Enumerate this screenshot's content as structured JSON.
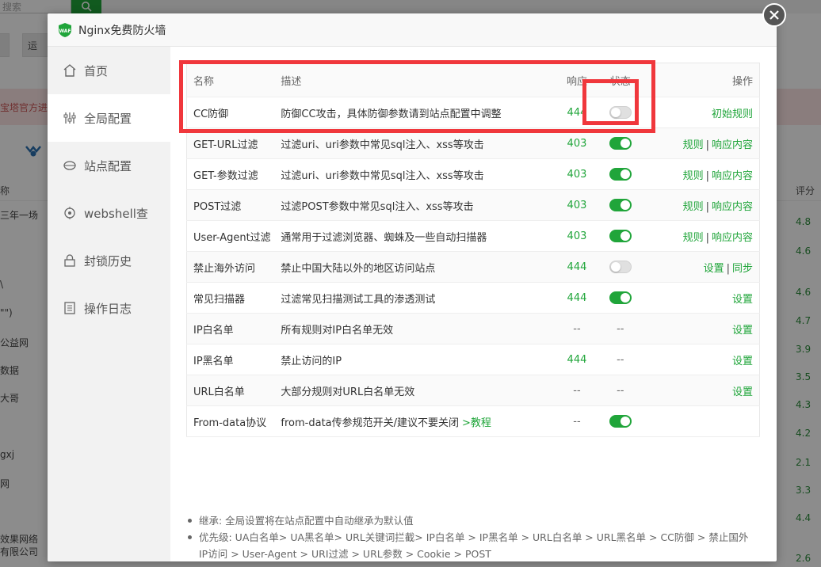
{
  "background": {
    "search_placeholder": "搜索",
    "tab_partial": "运",
    "banner_partial": "宝塔官方进",
    "col_partial": "称",
    "col_score": "评分",
    "rows": [
      {
        "name": "三年一场",
        "score": "4.8"
      },
      {
        "name": "",
        "score": "4.6"
      },
      {
        "name": "\\",
        "score": "4.6"
      },
      {
        "name": "\"\")",
        "score": "4.7"
      },
      {
        "name": "公益网",
        "score": "3.9"
      },
      {
        "name": "数据",
        "score": "3.5"
      },
      {
        "name": "大哥",
        "score": "4.3"
      },
      {
        "name": "",
        "score": "4.2"
      },
      {
        "name": "gxj",
        "score": "2.1"
      },
      {
        "name": "网",
        "score": "3.3"
      },
      {
        "name": "",
        "score": "4.4"
      },
      {
        "name": "效果网络",
        "score": ""
      },
      {
        "name": "有限公司",
        "score": "2.6"
      }
    ]
  },
  "modal": {
    "title": "Nginx免费防火墙",
    "close_icon": "close-icon"
  },
  "sidebar": {
    "items": [
      {
        "label": "首页",
        "icon": "home-icon"
      },
      {
        "label": "全局配置",
        "icon": "sliders-icon"
      },
      {
        "label": "站点配置",
        "icon": "site-icon"
      },
      {
        "label": "webshell查",
        "icon": "target-icon"
      },
      {
        "label": "封锁历史",
        "icon": "lock-icon"
      },
      {
        "label": "操作日志",
        "icon": "log-icon"
      }
    ]
  },
  "table": {
    "headers": {
      "name": "名称",
      "desc": "描述",
      "resp": "响应",
      "state": "状态",
      "ops": "操作"
    },
    "rows": [
      {
        "name": "CC防御",
        "desc": "防御CC攻击，具体防御参数请到站点配置中调整",
        "resp": "444",
        "state": "off",
        "ops": [
          "初始规则"
        ]
      },
      {
        "name": "GET-URL过滤",
        "desc": "过滤uri、uri参数中常见sql注入、xss等攻击",
        "resp": "403",
        "state": "on",
        "ops": [
          "规则",
          "响应内容"
        ]
      },
      {
        "name": "GET-参数过滤",
        "desc": "过滤uri、uri参数中常见sql注入、xss等攻击",
        "resp": "403",
        "state": "on",
        "ops": [
          "规则",
          "响应内容"
        ]
      },
      {
        "name": "POST过滤",
        "desc": "过滤POST参数中常见sql注入、xss等攻击",
        "resp": "403",
        "state": "on",
        "ops": [
          "规则",
          "响应内容"
        ]
      },
      {
        "name": "User-Agent过滤",
        "desc": "通常用于过滤浏览器、蜘蛛及一些自动扫描器",
        "resp": "403",
        "state": "on",
        "ops": [
          "规则",
          "响应内容"
        ]
      },
      {
        "name": "禁止海外访问",
        "desc": "禁止中国大陆以外的地区访问站点",
        "resp": "444",
        "state": "off",
        "ops": [
          "设置",
          "同步"
        ]
      },
      {
        "name": "常见扫描器",
        "desc": "过滤常见扫描测试工具的渗透测试",
        "resp": "444",
        "state": "on",
        "ops": [
          "设置"
        ]
      },
      {
        "name": "IP白名单",
        "desc": "所有规则对IP白名单无效",
        "resp": "--",
        "state": "--",
        "ops": [
          "设置"
        ]
      },
      {
        "name": "IP黑名单",
        "desc": "禁止访问的IP",
        "resp": "444",
        "state": "--",
        "ops": [
          "设置"
        ]
      },
      {
        "name": "URL白名单",
        "desc": "大部分规则对URL白名单无效",
        "resp": "--",
        "state": "--",
        "ops": [
          "设置"
        ]
      },
      {
        "name": "From-data协议",
        "desc": "from-data传参规范开关/建议不要关闭",
        "desc_link": ">教程",
        "resp": "--",
        "state": "on",
        "ops": []
      }
    ]
  },
  "notes": [
    "继承: 全局设置将在站点配置中自动继承为默认值",
    "优先级: UA白名单> UA黑名单> URL关键词拦截> IP白名单 > IP黑名单 > URL白名单 > URL黑名单 > CC防御 > 禁止国外IP访问 > User-Agent > URI过滤 > URL参数 > Cookie > POST"
  ],
  "colors": {
    "accent": "#20a53a",
    "highlight": "#f0373c"
  }
}
